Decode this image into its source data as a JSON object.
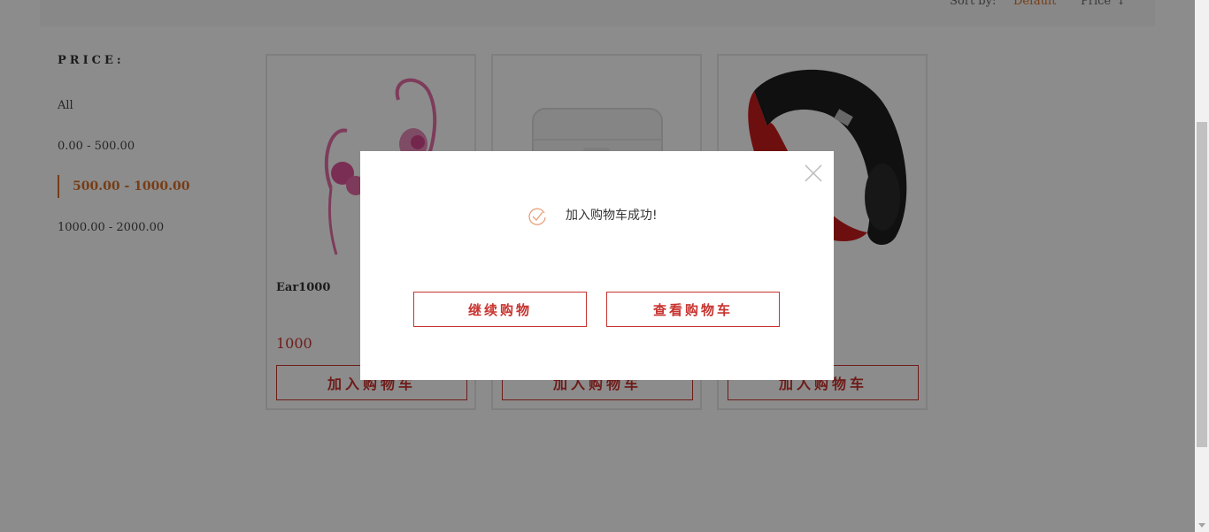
{
  "toolbar": {
    "sort_label": "Sort by:",
    "sort_default": "Default",
    "sort_price": "Price",
    "sort_price_icon": "arrow-down-icon"
  },
  "filter": {
    "title": "PRICE:",
    "items": [
      {
        "label": "All",
        "active": false
      },
      {
        "label": "0.00 - 500.00",
        "active": false
      },
      {
        "label": "500.00 - 1000.00",
        "active": true
      },
      {
        "label": "1000.00 - 2000.00",
        "active": false
      }
    ]
  },
  "products": [
    {
      "name": "Ear1000",
      "price": "1000",
      "button": "加入购物车",
      "image": "pink-earphones"
    },
    {
      "name": "",
      "price": "",
      "button": "加入购物车",
      "image": "white-earbuds-case"
    },
    {
      "name": "",
      "price": "",
      "button": "加入购物车",
      "image": "red-black-headphones"
    }
  ],
  "modal": {
    "message": "加入购物车成功!",
    "continue_label": "继续购物",
    "view_cart_label": "查看购物车",
    "icon": "check-circle-icon",
    "close_icon": "close-icon"
  },
  "colors": {
    "accent": "#d8702a",
    "brand_red": "#c8342f",
    "overlay": "rgba(0,0,0,0.45)"
  }
}
